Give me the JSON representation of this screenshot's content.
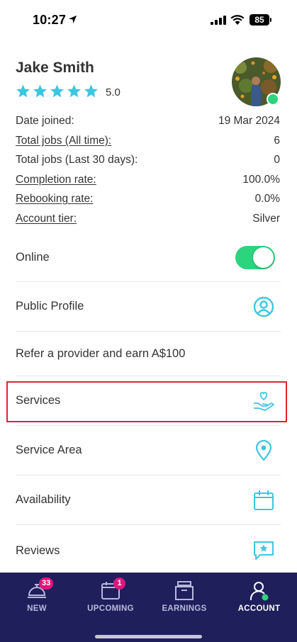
{
  "status_bar": {
    "time": "10:27",
    "battery": "85"
  },
  "profile": {
    "name": "Jake Smith",
    "rating": "5.0",
    "stars": 5
  },
  "stats": [
    {
      "label": "Date joined:",
      "value": "19 Mar 2024",
      "underline": false
    },
    {
      "label": "Total jobs (All time):",
      "value": "6",
      "underline": true
    },
    {
      "label": "Total jobs (Last 30 days):",
      "value": "0",
      "underline": false
    },
    {
      "label": "Completion rate:",
      "value": "100.0%",
      "underline": true
    },
    {
      "label": "Rebooking rate:",
      "value": "0.0%",
      "underline": true
    },
    {
      "label": "Account tier:",
      "value": "Silver",
      "underline": true
    }
  ],
  "menu": {
    "online": "Online",
    "public_profile": "Public Profile",
    "refer": "Refer a provider and earn A$100",
    "services": "Services",
    "service_area": "Service Area",
    "availability": "Availability",
    "reviews": "Reviews"
  },
  "nav": {
    "new": {
      "label": "NEW",
      "badge": "33"
    },
    "upcoming": {
      "label": "UPCOMING",
      "badge": "1"
    },
    "earnings": {
      "label": "EARNINGS"
    },
    "account": {
      "label": "ACCOUNT"
    }
  },
  "colors": {
    "accent": "#3ec6e0",
    "online_green": "#2bd47d",
    "nav_bg": "#1f1f5c",
    "badge": "#e0167c",
    "highlight": "#d9262f"
  }
}
